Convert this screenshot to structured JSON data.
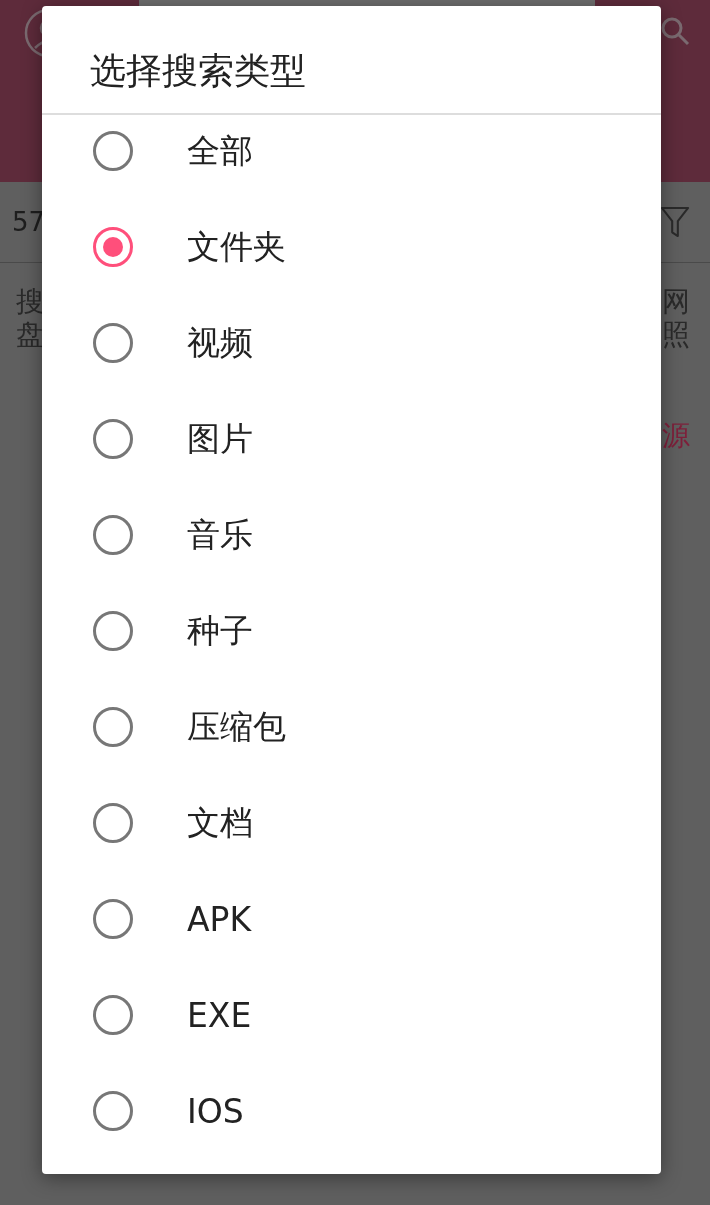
{
  "background": {
    "count_text": "57",
    "left_lines": [
      "搜",
      "盘"
    ],
    "right_lines": [
      "网",
      "照"
    ],
    "source_link": "源"
  },
  "dialog": {
    "title": "选择搜索类型",
    "options": [
      {
        "label": "全部",
        "selected": false
      },
      {
        "label": "文件夹",
        "selected": true
      },
      {
        "label": "视频",
        "selected": false
      },
      {
        "label": "图片",
        "selected": false
      },
      {
        "label": "音乐",
        "selected": false
      },
      {
        "label": "种子",
        "selected": false
      },
      {
        "label": "压缩包",
        "selected": false
      },
      {
        "label": "文档",
        "selected": false
      },
      {
        "label": "APK",
        "selected": false
      },
      {
        "label": "EXE",
        "selected": false
      },
      {
        "label": "IOS",
        "selected": false
      }
    ]
  }
}
